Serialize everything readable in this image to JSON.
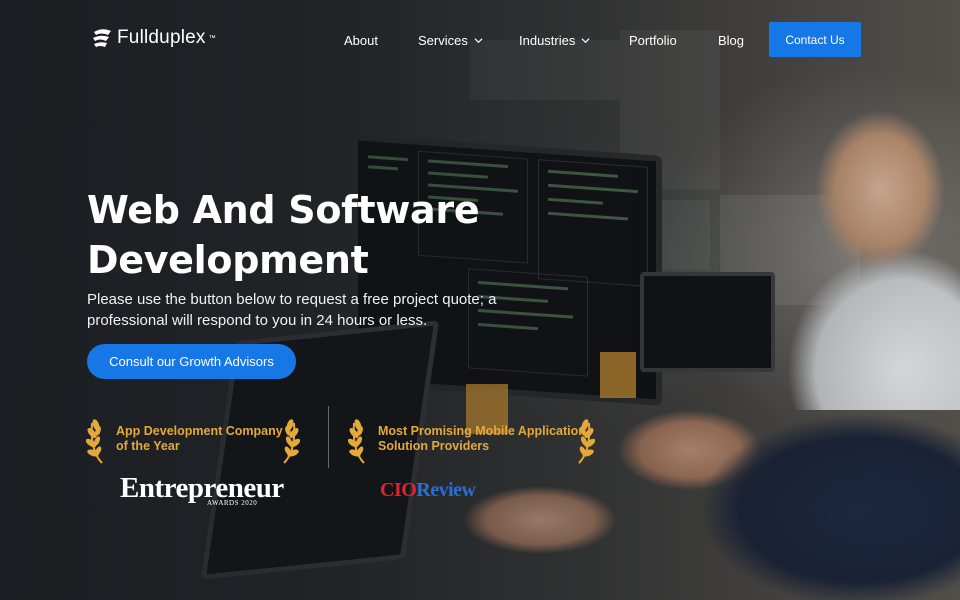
{
  "brand": {
    "name": "Fullduplex",
    "tm": "™"
  },
  "nav": {
    "items": [
      {
        "label": "About",
        "has_dropdown": false
      },
      {
        "label": "Services",
        "has_dropdown": true
      },
      {
        "label": "Industries",
        "has_dropdown": true
      },
      {
        "label": "Portfolio",
        "has_dropdown": false
      },
      {
        "label": "Blog",
        "has_dropdown": false
      }
    ],
    "contact_label": "Contact Us"
  },
  "hero": {
    "title_line1": "Web And Software",
    "title_line2": "Development",
    "subtitle": "Please use the button below to request a free project quote; a professional will respond to you in 24 hours or less.",
    "cta_label": "Consult our Growth Advisors"
  },
  "awards": [
    {
      "line1": "App Development Company",
      "line2": "of the Year",
      "logo_text": "Entrepreneur",
      "logo_sub": "AWARDS 2020"
    },
    {
      "line1": "Most Promising Mobile Application",
      "line2": "Solution Providers",
      "logo_part1": "CIO",
      "logo_part2": "Review"
    }
  ],
  "colors": {
    "accent": "#1677e6",
    "award_gold": "#e5a93a",
    "cio_red": "#e2242b",
    "cio_blue": "#2a6fd6"
  },
  "icons": {
    "nav_dropdown": "chevron-down-icon",
    "award": "laurel-icon",
    "logo": "fullduplex-logo-icon"
  }
}
